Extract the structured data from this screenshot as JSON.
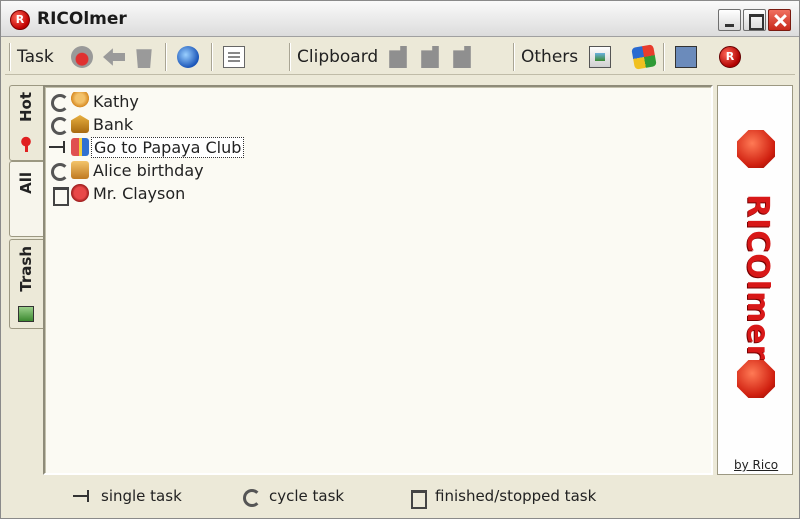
{
  "window": {
    "title": "RICOlmer"
  },
  "toolbar": {
    "task_label": "Task",
    "clipboard_label": "Clipboard",
    "others_label": "Others",
    "icons": [
      "hot-task-icon",
      "back-arrow-icon",
      "delete-icon",
      "globe-icon",
      "document-icon",
      "clipboard-copy-icon",
      "clipboard-cut-icon",
      "clipboard-paste-icon",
      "image-icon",
      "windows-icon",
      "search-icon",
      "ricolmer-logo-icon"
    ]
  },
  "tabs": [
    {
      "label": "Hot",
      "icon": "hot-icon"
    },
    {
      "label": "All",
      "icon": ""
    },
    {
      "label": "Trash",
      "icon": "recycle-icon"
    }
  ],
  "tasks": [
    {
      "name": "Kathy",
      "type": "cycle",
      "category": "person"
    },
    {
      "name": "Bank",
      "type": "cycle",
      "category": "bank"
    },
    {
      "name": "Go to Papaya Club",
      "type": "single",
      "category": "gift",
      "selected": true
    },
    {
      "name": "Alice birthday",
      "type": "cycle",
      "category": "box"
    },
    {
      "name": "Mr. Clayson",
      "type": "trash",
      "category": "heart"
    }
  ],
  "brand": {
    "text": "RICOlmer",
    "by": "by Rico"
  },
  "legend": {
    "single": "single task",
    "cycle": "cycle task",
    "finished": "finished/stopped task"
  },
  "colors": {
    "brand_red": "#d81818",
    "list_bg": "#fbfaf3",
    "window_bg": "#ece9d8"
  }
}
